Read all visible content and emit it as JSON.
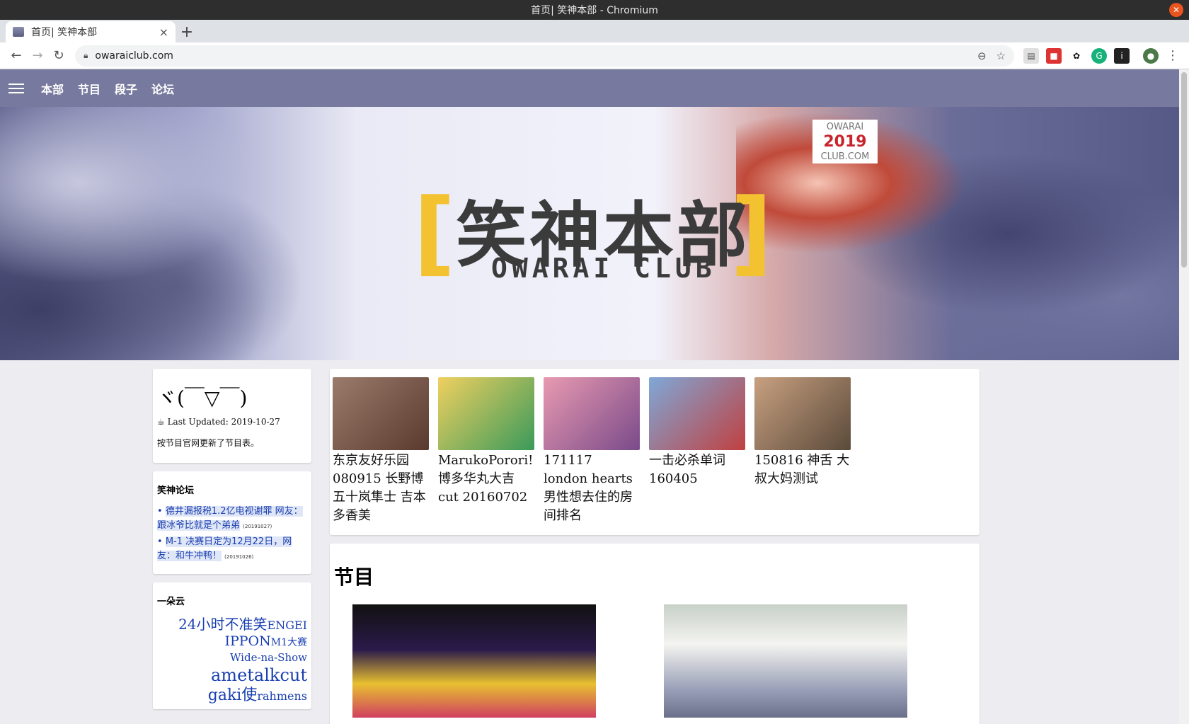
{
  "window": {
    "title": "首页| 笑神本部 - Chromium"
  },
  "tabs": [
    {
      "title": "首页| 笑神本部"
    }
  ],
  "address_bar": {
    "url": "owaraiclub.com"
  },
  "site_nav": {
    "items": [
      "本部",
      "节目",
      "段子",
      "论坛"
    ]
  },
  "banner": {
    "title_zh": "笑神本部",
    "title_en": "OWARAI CLUB",
    "badge_top": "OWARAI",
    "badge_year": "2019",
    "badge_bottom": "CLUB.COM"
  },
  "sidebar": {
    "status": {
      "emoticon": "ヾ(￣▽￣)",
      "updated": "Last Updated: 2019-10-27",
      "note": "按节目官网更新了节目表。"
    },
    "forum": {
      "title": "笑神论坛",
      "items": [
        {
          "text": "德井漏报税1.2亿电视谢罪 网友：跟冰爷比就是个弟弟",
          "date": "(20191027)"
        },
        {
          "text": "M-1 决赛日定为12月22日，网友：和牛冲鸭！",
          "date": "(20191026)"
        }
      ]
    },
    "tagcloud": {
      "title": "一朵云",
      "tags": [
        "24小时不准笑",
        "ENGEI",
        "IPPON",
        "M1大赛",
        "Wide-na-Show",
        "ametalk",
        "cut",
        "gaki使",
        "rahmens"
      ]
    }
  },
  "featured": [
    {
      "caption": "东京友好乐园 080915 长野博 五十岚隼士 吉本多香美",
      "color": "#7a5a4c"
    },
    {
      "caption": "MarukoPorori! 博多华丸大吉 cut 20160702",
      "color": "#d8b040"
    },
    {
      "caption": "171117 london hearts 男性想去住的房间排名",
      "color": "#c77a8c"
    },
    {
      "caption": "一击必杀单词 160405",
      "color": "#5b7fb8"
    },
    {
      "caption": "150816 神舌 大叔大妈测试",
      "color": "#8a6a58"
    }
  ],
  "shows_section": {
    "title": "节目"
  },
  "colors": {
    "nav_bg": "#777a9e",
    "accent_yellow": "#f3c230",
    "link": "#1a3fb0"
  }
}
